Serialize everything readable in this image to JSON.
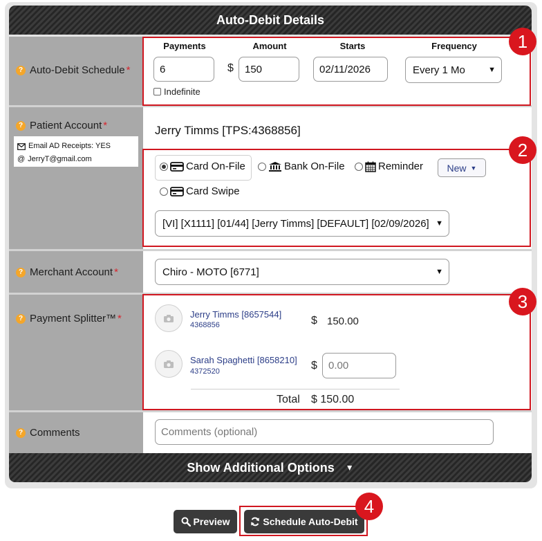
{
  "header": {
    "title": "Auto-Debit Details"
  },
  "schedule": {
    "label": "Auto-Debit Schedule",
    "required_mark": "*",
    "cols": {
      "payments": "Payments",
      "amount": "Amount",
      "starts": "Starts",
      "frequency": "Frequency"
    },
    "payments_value": "6",
    "currency": "$",
    "amount_value": "150",
    "start_value": "02/11/2026",
    "frequency_value": "Every 1 Mo",
    "indefinite_label": "Indefinite",
    "indefinite_checked": false
  },
  "patient": {
    "label": "Patient Account",
    "required_mark": "*",
    "name": "Jerry Timms [TPS:4368856]",
    "receipts": "Email AD Receipts: YES",
    "email_prefix": "@",
    "email": "JerryT@gmail.com",
    "methods": [
      {
        "label": "Card On-File",
        "icon": "credit-card-icon",
        "selected": true
      },
      {
        "label": "Bank On-File",
        "icon": "bank-icon",
        "selected": false
      },
      {
        "label": "Reminder",
        "icon": "calendar-icon",
        "selected": false
      },
      {
        "label": "Card Swipe",
        "icon": "credit-card-icon",
        "selected": false
      }
    ],
    "new_button": "New",
    "card_value": "[VI] [X1111] [01/44] [Jerry Timms] [DEFAULT] [02/09/2026]"
  },
  "merchant": {
    "label": "Merchant Account",
    "required_mark": "*",
    "value": "Chiro - MOTO [6771]"
  },
  "splitter": {
    "label": "Payment Splitter™",
    "required_mark": "*",
    "people": [
      {
        "name": "Jerry Timms [8657544]",
        "id": "4368856",
        "currency": "$",
        "amount": "150.00",
        "editable": false
      },
      {
        "name": "Sarah Spaghetti [8658210]",
        "id": "4372520",
        "currency": "$",
        "placeholder": "0.00",
        "editable": true
      }
    ],
    "total_label": "Total",
    "total_value": "$ 150.00"
  },
  "comments": {
    "label": "Comments",
    "placeholder": "Comments (optional)"
  },
  "footer": {
    "label": "Show Additional Options"
  },
  "actions": {
    "preview": "Preview",
    "schedule": "Schedule Auto-Debit"
  },
  "callouts": [
    "1",
    "2",
    "3",
    "4"
  ],
  "colors": {
    "accent_red": "#d0161f",
    "label_bg": "#a9a9a9",
    "dark_bar": "#2d2d2d",
    "help_orange": "#f4a62a",
    "link_blue": "#2b3d87"
  }
}
